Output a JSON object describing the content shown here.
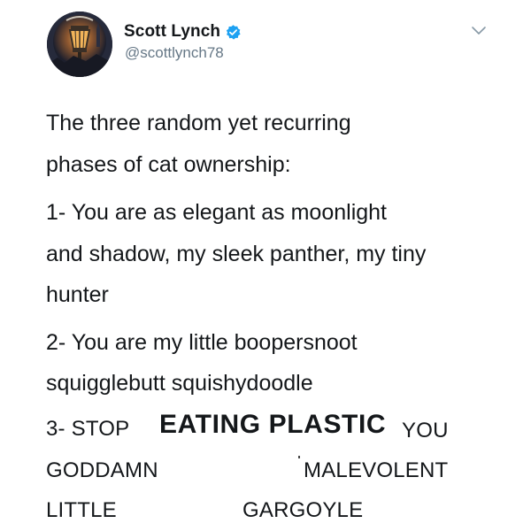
{
  "author": {
    "display_name": "Scott Lynch",
    "handle": "@scottlynch78",
    "verified": true,
    "avatar_icon": "lantern-avatar-icon",
    "verified_color": "#1da1f2"
  },
  "tweet": {
    "lines": [
      "The three random yet recurring",
      "phases of cat ownership:",
      "1- You are as elegant as moonlight",
      "and shadow, my sleek panther, my tiny",
      "hunter",
      "2- You are my little boopersnoot",
      "squigglebutt squishydoodle"
    ],
    "phase3": {
      "stop": "3- STOP",
      "eating_plastic": "EATING PLASTIC",
      "you": "YOU",
      "goddamn": "GODDAMN",
      "malevolent": "MALEVOLENT",
      "little": "LITTLE",
      "gargoyle": "GARGOYLE"
    }
  },
  "menu_icon": "chevron-down-icon"
}
